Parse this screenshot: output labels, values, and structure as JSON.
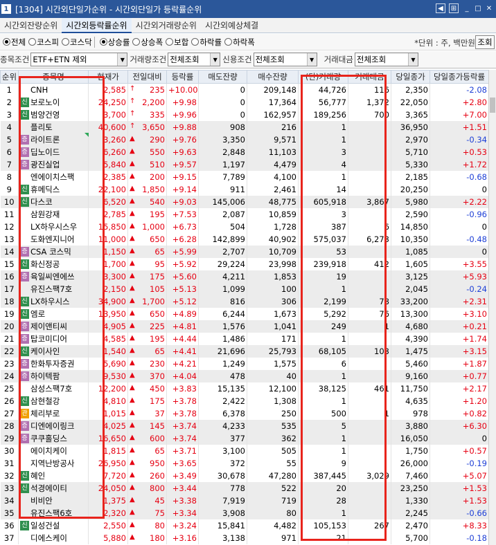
{
  "window": {
    "number": "1",
    "title": "[1304] 시간외단일가순위 - 시간외단일가 등락률순위",
    "icons": [
      "back-icon",
      "menu-icon",
      "minimize-icon",
      "maximize-icon",
      "close-icon"
    ]
  },
  "tabs": [
    {
      "label": "시간외잔량순위",
      "active": false
    },
    {
      "label": "시간외등락률순위",
      "active": true
    },
    {
      "label": "시간외거래량순위",
      "active": false
    },
    {
      "label": "시간외예상체결",
      "active": false
    }
  ],
  "market_radios": [
    {
      "label": "전체",
      "selected": true
    },
    {
      "label": "코스피",
      "selected": false
    },
    {
      "label": "코스닥",
      "selected": false
    }
  ],
  "rank_radios": [
    {
      "label": "상승률",
      "selected": true
    },
    {
      "label": "상승폭",
      "selected": false
    },
    {
      "label": "보합",
      "selected": false
    },
    {
      "label": "하락률",
      "selected": false
    },
    {
      "label": "하락폭",
      "selected": false
    }
  ],
  "unit_text": "*단위 : 주, 백만원",
  "lookup_label": "조회",
  "conditions": {
    "stock_label": "종목조건",
    "stock_value": "ETF+ETN 제외",
    "volume_label": "거래량조건",
    "volume_value": "전체조회",
    "credit_label": "신용조건",
    "credit_value": "전체조회",
    "amount_label": "거래대금",
    "amount_value": "전체조회"
  },
  "colors": {
    "up": "#e60012",
    "down": "#1d3fd6",
    "highlight_box": "#e8241c",
    "badge_new": "#2f8f4e",
    "badge_jeung": "#b070b0",
    "badge_gwan": "#f0a000"
  },
  "columns": [
    "순위",
    "종목명",
    "현재가",
    "전일대비",
    "등락률",
    "매도잔량",
    "매수잔량",
    "(단)거래량",
    "거래대금",
    "당일종가",
    "당일종가등락률"
  ],
  "rows": [
    {
      "rank": "1",
      "badge": "",
      "name": "CNH",
      "price": "2,585",
      "arrow": "↑",
      "change": "235",
      "rate": "+10.00",
      "ask": "0",
      "bid": "209,148",
      "vol": "44,726",
      "amt": "116",
      "close": "2,350",
      "crate": "-2.08",
      "cdir": "dn"
    },
    {
      "rank": "2",
      "badge": "신",
      "name": "보로노이",
      "price": "24,250",
      "arrow": "↑",
      "change": "2,200",
      "rate": "+9.98",
      "ask": "0",
      "bid": "17,364",
      "vol": "56,777",
      "amt": "1,372",
      "close": "22,050",
      "crate": "+2.80",
      "cdir": "up"
    },
    {
      "rank": "3",
      "badge": "신",
      "name": "범양건영",
      "price": "3,700",
      "arrow": "↑",
      "change": "335",
      "rate": "+9.96",
      "ask": "0",
      "bid": "162,957",
      "vol": "189,256",
      "amt": "700",
      "close": "3,365",
      "crate": "+7.00",
      "cdir": "up"
    },
    {
      "rank": "4",
      "badge": "",
      "name": "플리토",
      "price": "40,600",
      "arrow": "↑",
      "change": "3,650",
      "rate": "+9.88",
      "ask": "908",
      "bid": "216",
      "vol": "1",
      "amt": "",
      "close": "36,950",
      "crate": "+1.51",
      "cdir": "up"
    },
    {
      "rank": "5",
      "badge": "증",
      "name": "라이트론",
      "price": "3,260",
      "arrow": "▲",
      "change": "290",
      "rate": "+9.76",
      "ask": "3,350",
      "bid": "9,571",
      "vol": "1",
      "amt": "",
      "close": "2,970",
      "crate": "-0.34",
      "cdir": "dn"
    },
    {
      "rank": "6",
      "badge": "증",
      "name": "딥노이드",
      "price": "6,260",
      "arrow": "▲",
      "change": "550",
      "rate": "+9.63",
      "ask": "2,848",
      "bid": "11,103",
      "vol": "3",
      "amt": "",
      "close": "5,710",
      "crate": "+0.53",
      "cdir": "up"
    },
    {
      "rank": "7",
      "badge": "증",
      "name": "광진실업",
      "price": "5,840",
      "arrow": "▲",
      "change": "510",
      "rate": "+9.57",
      "ask": "1,197",
      "bid": "4,479",
      "vol": "4",
      "amt": "",
      "close": "5,330",
      "crate": "+1.72",
      "cdir": "up"
    },
    {
      "rank": "8",
      "badge": "",
      "name": "엔에이치스팩",
      "price": "2,385",
      "arrow": "▲",
      "change": "200",
      "rate": "+9.15",
      "ask": "7,789",
      "bid": "4,100",
      "vol": "1",
      "amt": "",
      "close": "2,185",
      "crate": "-0.68",
      "cdir": "dn"
    },
    {
      "rank": "9",
      "badge": "신",
      "name": "휴메딕스",
      "price": "22,100",
      "arrow": "▲",
      "change": "1,850",
      "rate": "+9.14",
      "ask": "911",
      "bid": "2,461",
      "vol": "14",
      "amt": "",
      "close": "20,250",
      "crate": "0",
      "cdir": ""
    },
    {
      "rank": "10",
      "badge": "신",
      "name": "다스코",
      "price": "6,520",
      "arrow": "▲",
      "change": "540",
      "rate": "+9.03",
      "ask": "145,006",
      "bid": "48,775",
      "vol": "605,918",
      "amt": "3,867",
      "close": "5,980",
      "crate": "+2.22",
      "cdir": "up"
    },
    {
      "rank": "11",
      "badge": "",
      "name": "삼원강재",
      "price": "2,785",
      "arrow": "▲",
      "change": "195",
      "rate": "+7.53",
      "ask": "2,087",
      "bid": "10,859",
      "vol": "3",
      "amt": "",
      "close": "2,590",
      "crate": "-0.96",
      "cdir": "dn"
    },
    {
      "rank": "12",
      "badge": "",
      "name": "LX하우시스우",
      "price": "15,850",
      "arrow": "▲",
      "change": "1,000",
      "rate": "+6.73",
      "ask": "504",
      "bid": "1,728",
      "vol": "387",
      "amt": "6",
      "close": "14,850",
      "crate": "0",
      "cdir": ""
    },
    {
      "rank": "13",
      "badge": "",
      "name": "도화엔지니어",
      "price": "11,000",
      "arrow": "▲",
      "change": "650",
      "rate": "+6.28",
      "ask": "142,899",
      "bid": "40,902",
      "vol": "575,037",
      "amt": "6,273",
      "close": "10,350",
      "crate": "-0.48",
      "cdir": "dn"
    },
    {
      "rank": "14",
      "badge": "증",
      "name": "CSA 코스믹",
      "price": "1,150",
      "arrow": "▲",
      "change": "65",
      "rate": "+5.99",
      "ask": "2,707",
      "bid": "10,709",
      "vol": "53",
      "amt": "",
      "close": "1,085",
      "crate": "0",
      "cdir": ""
    },
    {
      "rank": "15",
      "badge": "신",
      "name": "화신정공",
      "price": "1,700",
      "arrow": "▲",
      "change": "95",
      "rate": "+5.92",
      "ask": "29,224",
      "bid": "23,998",
      "vol": "239,918",
      "amt": "412",
      "close": "1,605",
      "crate": "+3.55",
      "cdir": "up"
    },
    {
      "rank": "16",
      "badge": "증",
      "name": "육일씨엔에쓰",
      "price": "3,300",
      "arrow": "▲",
      "change": "175",
      "rate": "+5.60",
      "ask": "4,211",
      "bid": "1,853",
      "vol": "19",
      "amt": "",
      "close": "3,125",
      "crate": "+5.93",
      "cdir": "up"
    },
    {
      "rank": "17",
      "badge": "",
      "name": "유진스팩7호",
      "price": "2,150",
      "arrow": "▲",
      "change": "105",
      "rate": "+5.13",
      "ask": "1,099",
      "bid": "100",
      "vol": "1",
      "amt": "",
      "close": "2,045",
      "crate": "-0.24",
      "cdir": "dn"
    },
    {
      "rank": "18",
      "badge": "신",
      "name": "LX하우시스",
      "price": "34,900",
      "arrow": "▲",
      "change": "1,700",
      "rate": "+5.12",
      "ask": "816",
      "bid": "306",
      "vol": "2,199",
      "amt": "78",
      "close": "33,200",
      "crate": "+2.31",
      "cdir": "up"
    },
    {
      "rank": "19",
      "badge": "신",
      "name": "엠로",
      "price": "13,950",
      "arrow": "▲",
      "change": "650",
      "rate": "+4.89",
      "ask": "6,244",
      "bid": "1,673",
      "vol": "5,292",
      "amt": "76",
      "close": "13,300",
      "crate": "+3.10",
      "cdir": "up"
    },
    {
      "rank": "20",
      "badge": "증",
      "name": "제이앤티씨",
      "price": "4,905",
      "arrow": "▲",
      "change": "225",
      "rate": "+4.81",
      "ask": "1,576",
      "bid": "1,041",
      "vol": "249",
      "amt": "1",
      "close": "4,680",
      "crate": "+0.21",
      "cdir": "up"
    },
    {
      "rank": "21",
      "badge": "증",
      "name": "탑코미디어",
      "price": "4,585",
      "arrow": "▲",
      "change": "195",
      "rate": "+4.44",
      "ask": "1,486",
      "bid": "171",
      "vol": "1",
      "amt": "",
      "close": "4,390",
      "crate": "+1.74",
      "cdir": "up"
    },
    {
      "rank": "22",
      "badge": "신",
      "name": "케이사인",
      "price": "1,540",
      "arrow": "▲",
      "change": "65",
      "rate": "+4.41",
      "ask": "21,696",
      "bid": "25,793",
      "vol": "68,105",
      "amt": "103",
      "close": "1,475",
      "crate": "+3.15",
      "cdir": "up"
    },
    {
      "rank": "23",
      "badge": "증",
      "name": "한화투자증권",
      "price": "5,690",
      "arrow": "▲",
      "change": "230",
      "rate": "+4.21",
      "ask": "1,249",
      "bid": "1,575",
      "vol": "6",
      "amt": "",
      "close": "5,460",
      "crate": "+1.87",
      "cdir": "up"
    },
    {
      "rank": "24",
      "badge": "증",
      "name": "하이텍팜",
      "price": "9,530",
      "arrow": "▲",
      "change": "370",
      "rate": "+4.04",
      "ask": "478",
      "bid": "40",
      "vol": "1",
      "amt": "",
      "close": "9,160",
      "crate": "+0.77",
      "cdir": "up"
    },
    {
      "rank": "25",
      "badge": "",
      "name": "삼성스팩7호",
      "price": "12,200",
      "arrow": "▲",
      "change": "450",
      "rate": "+3.83",
      "ask": "15,135",
      "bid": "12,100",
      "vol": "38,125",
      "amt": "461",
      "close": "11,750",
      "crate": "+2.17",
      "cdir": "up"
    },
    {
      "rank": "26",
      "badge": "신",
      "name": "삼현철강",
      "price": "4,810",
      "arrow": "▲",
      "change": "175",
      "rate": "+3.78",
      "ask": "2,422",
      "bid": "1,308",
      "vol": "1",
      "amt": "",
      "close": "4,635",
      "crate": "+1.20",
      "cdir": "up"
    },
    {
      "rank": "27",
      "badge": "관",
      "name": "체리부로",
      "price": "1,015",
      "arrow": "▲",
      "change": "37",
      "rate": "+3.78",
      "ask": "6,378",
      "bid": "250",
      "vol": "500",
      "amt": "1",
      "close": "978",
      "crate": "+0.82",
      "cdir": "up"
    },
    {
      "rank": "28",
      "badge": "증",
      "name": "디엔에이링크",
      "price": "4,025",
      "arrow": "▲",
      "change": "145",
      "rate": "+3.74",
      "ask": "4,233",
      "bid": "535",
      "vol": "5",
      "amt": "",
      "close": "3,880",
      "crate": "+6.30",
      "cdir": "up"
    },
    {
      "rank": "29",
      "badge": "증",
      "name": "쿠쿠홀딩스",
      "price": "16,650",
      "arrow": "▲",
      "change": "600",
      "rate": "+3.74",
      "ask": "377",
      "bid": "362",
      "vol": "1",
      "amt": "",
      "close": "16,050",
      "crate": "0",
      "cdir": ""
    },
    {
      "rank": "30",
      "badge": "",
      "name": "에이치케이",
      "price": "1,815",
      "arrow": "▲",
      "change": "65",
      "rate": "+3.71",
      "ask": "3,100",
      "bid": "505",
      "vol": "1",
      "amt": "",
      "close": "1,750",
      "crate": "+0.57",
      "cdir": "up"
    },
    {
      "rank": "31",
      "badge": "",
      "name": "지역난방공사",
      "price": "26,950",
      "arrow": "▲",
      "change": "950",
      "rate": "+3.65",
      "ask": "372",
      "bid": "55",
      "vol": "9",
      "amt": "",
      "close": "26,000",
      "crate": "-0.19",
      "cdir": "dn"
    },
    {
      "rank": "32",
      "badge": "신",
      "name": "혜인",
      "price": "7,720",
      "arrow": "▲",
      "change": "260",
      "rate": "+3.49",
      "ask": "30,678",
      "bid": "47,280",
      "vol": "387,445",
      "amt": "3,029",
      "close": "7,460",
      "crate": "+5.07",
      "cdir": "up"
    },
    {
      "rank": "33",
      "badge": "신",
      "name": "석경에이티",
      "price": "24,050",
      "arrow": "▲",
      "change": "800",
      "rate": "+3.44",
      "ask": "778",
      "bid": "522",
      "vol": "20",
      "amt": "",
      "close": "23,250",
      "crate": "+1.53",
      "cdir": "up"
    },
    {
      "rank": "34",
      "badge": "",
      "name": "비비안",
      "price": "1,375",
      "arrow": "▲",
      "change": "45",
      "rate": "+3.38",
      "ask": "7,919",
      "bid": "719",
      "vol": "28",
      "amt": "",
      "close": "1,330",
      "crate": "+1.53",
      "cdir": "up"
    },
    {
      "rank": "35",
      "badge": "",
      "name": "유진스팩6호",
      "price": "2,320",
      "arrow": "▲",
      "change": "75",
      "rate": "+3.34",
      "ask": "3,908",
      "bid": "80",
      "vol": "1",
      "amt": "",
      "close": "2,245",
      "crate": "-0.66",
      "cdir": "dn"
    },
    {
      "rank": "36",
      "badge": "신",
      "name": "일성건설",
      "price": "2,550",
      "arrow": "▲",
      "change": "80",
      "rate": "+3.24",
      "ask": "15,841",
      "bid": "4,482",
      "vol": "105,153",
      "amt": "267",
      "close": "2,470",
      "crate": "+8.33",
      "cdir": "up"
    },
    {
      "rank": "37",
      "badge": "",
      "name": "디에스케이",
      "price": "5,880",
      "arrow": "▲",
      "change": "180",
      "rate": "+3.16",
      "ask": "3,138",
      "bid": "971",
      "vol": "21",
      "amt": "",
      "close": "5,700",
      "crate": "-0.18",
      "cdir": "dn"
    }
  ]
}
